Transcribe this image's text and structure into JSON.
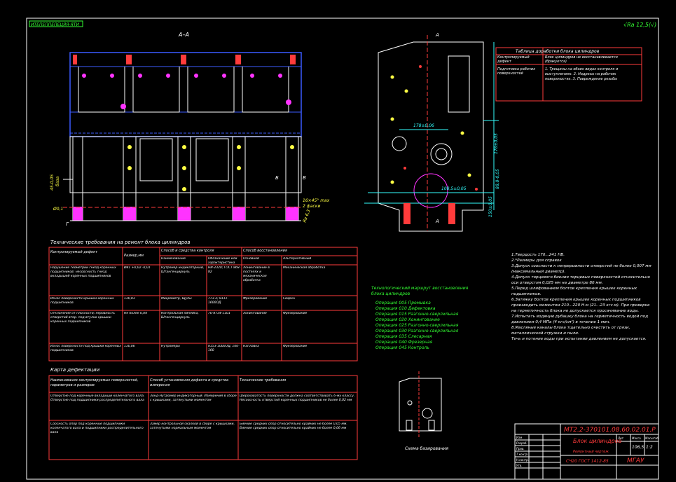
{
  "drawing": {
    "stamp_top_left": "ИТЕПЕППЕПЕЦЯЯ-ЯТИ",
    "roughness": "√Ra 12,5(√)",
    "section_label": "А–А",
    "cut_label_a": "А",
    "cut_label_b": "Б",
    "cut_label_v": "В",
    "cut_label_g": "Г",
    "dim_left": "45-0,05",
    "dim_left_sub": "база",
    "dim_right_1": "178±0,05",
    "dim_right_2": "88,8-0,05",
    "dim_right_3": "150±0,05",
    "dim_right_4": "108,5±0,05",
    "dim_mid": "178±0,06",
    "tol_1": "Ø0,1",
    "tol_2": "16×45° max",
    "tol_3": "2 фаски",
    "tol_4": "Ra 6,3"
  },
  "tech_req_title": "Технические требования на ремонт блока цилиндров",
  "tech_table": {
    "headers": [
      "Контролируемый дефект",
      "Размер,мм",
      "Способ и средства контроля",
      "Способ восстановления"
    ],
    "sub_headers": [
      "Наименование",
      "Обозначение или характеристика",
      "Основной",
      "Альтернативный"
    ],
    "rows": [
      [
        "Нарушение геометрии гнезд коренных подшипников: несоосность гнезд вкладышей коренных подшипников",
        "Ø81 +0,02 -0,01",
        "Нутромер индикаторный, Штангенциркуль",
        "НИ-2320; ГОСТ 868-82",
        "Хонингование в постелях и механическая обработка",
        "Механическая обработка"
      ],
      [
        "Износ поверхности крышки коренных подшипников",
        "130,03",
        "Микрометр, Щупы",
        "773-2; 8111-1600ОД",
        "Фрезерование",
        "Сварка"
      ],
      [
        "Отклонение от плоскости; неровность отверстий втор. под втулки крышки коренных подшипников",
        "Не более 0,04",
        "Контрольная линейка, Штангенциркуль",
        "70-8734-1101",
        "Хонингование",
        "Фрезерование"
      ],
      [
        "Износ поверхности под крышки коренных подшипников",
        "130,06",
        "Нутромеры",
        "8153-1000ОД; 100-160",
        "Наплавка",
        "Фрезерование"
      ]
    ]
  },
  "control_title": "Карта дефектации",
  "control_table": {
    "headers": [
      "Наименование контролируемых поверхностей, параметров и размеров",
      "Способ установления дефекта и средства измерения",
      "Технические требования"
    ],
    "rows": [
      [
        "Отверстие под коренные вкладыши коленчатого вала. Отверстие под подшипники распределительного вала",
        "Зонд-Нутромер индикаторный. Измерения в сборе с крышками, затянутыми моментом",
        "Шероховатость поверхности должна соответствовать 6-му классу. Несоосность отверстий коренных подшипников не более 0,02 мм"
      ],
      [
        "Соосность опор под коренные подшипники коленчатого вала и подшипники распределительного вала",
        "Замер контрольной скалкой в сборе с крышками, затянутыми нормальным моментом",
        "Биение средних опор относительно крайних не более 0,05 мм. Биение средних опор относительно крайних не более 0,06 мм"
      ]
    ]
  },
  "route_title": "Технологический маршрут восстановления блока цилиндров",
  "route": [
    "Операция 005 Промывка",
    "Операция 010 Дефектовка",
    "Операция 015 Разгонно-сверлильная",
    "Операция 020 Хонингование",
    "Операция 025 Разгонно-сверлильная",
    "Операция 030 Разгонно-сверлильная",
    "Операция 035 Слесарная",
    "Операция 040 Фрезерная",
    "Операция 045 Контроль"
  ],
  "notes_right": [
    "1.Твердость 170...241 НВ.",
    "2.*Размеры для справок",
    "3.Допуск соосности к непрерывности отверстий не более 0,007 мм (максимальный диаметр).",
    "4.Допуск торцевого биения торцевых поверхностей относительно оси отверстия 0,025 мм на диаметре 80 мм.",
    "5.Перед шлифованием болтов крепления крышек коренных подшипников.",
    "6.Затяжку болтов крепления крышек коренных подшипников производить моментом 210...220 Н·м (21...23 кгс·м). При проверке на герметичность блока не допускается просачивание воды.",
    "7.Испытать водяную рубашку блока на герметичность водой под давлением 0,4 МПа (4 кгс/см²) в течение 1 мин.",
    "8.Масляные каналы блока тщательно очистить от грязи, металлической стружки и пыли.",
    "Течь и потение воды при испытании давлением не допускается."
  ],
  "table_heading_right": "Таблица доработки блока цилиндров",
  "table_right": [
    [
      "Контролируемый дефект",
      "Блок цилиндров не восстанавливается (бракуется)"
    ],
    [
      "Подготовка рабочих поверхностей",
      "1. Трещины на обоих видах контроля и выступлениях. 2. Надрезы на рабочих поверхностях. 3. Повреждение резьбы"
    ]
  ],
  "small_view_caption": "Схема базирования",
  "title_block": {
    "doc_code": "МТ2.2-370101.08.60.02.01.Р",
    "part_name": "Блок цилиндров",
    "drawing_kind": "Ремонтный чертеж",
    "material": "СЧ20 ГОСТ 1412-85",
    "mass": "106,5",
    "scale": "1:2",
    "org": "МГАУ",
    "row_labels": [
      "Изм",
      "Разраб.",
      "Пров.",
      "Т.контр.",
      "Н.контр.",
      "Утв."
    ],
    "col_labels": [
      "Лит.",
      "Масса",
      "Масштаб"
    ]
  },
  "colors": {
    "background": "#000000",
    "frame": "#ffffff",
    "red": "#ff3b3b",
    "blue": "#3b5bff",
    "green": "#33ff33",
    "yellow": "#ffff44",
    "magenta": "#ff33ff",
    "cyan": "#33ffff"
  }
}
